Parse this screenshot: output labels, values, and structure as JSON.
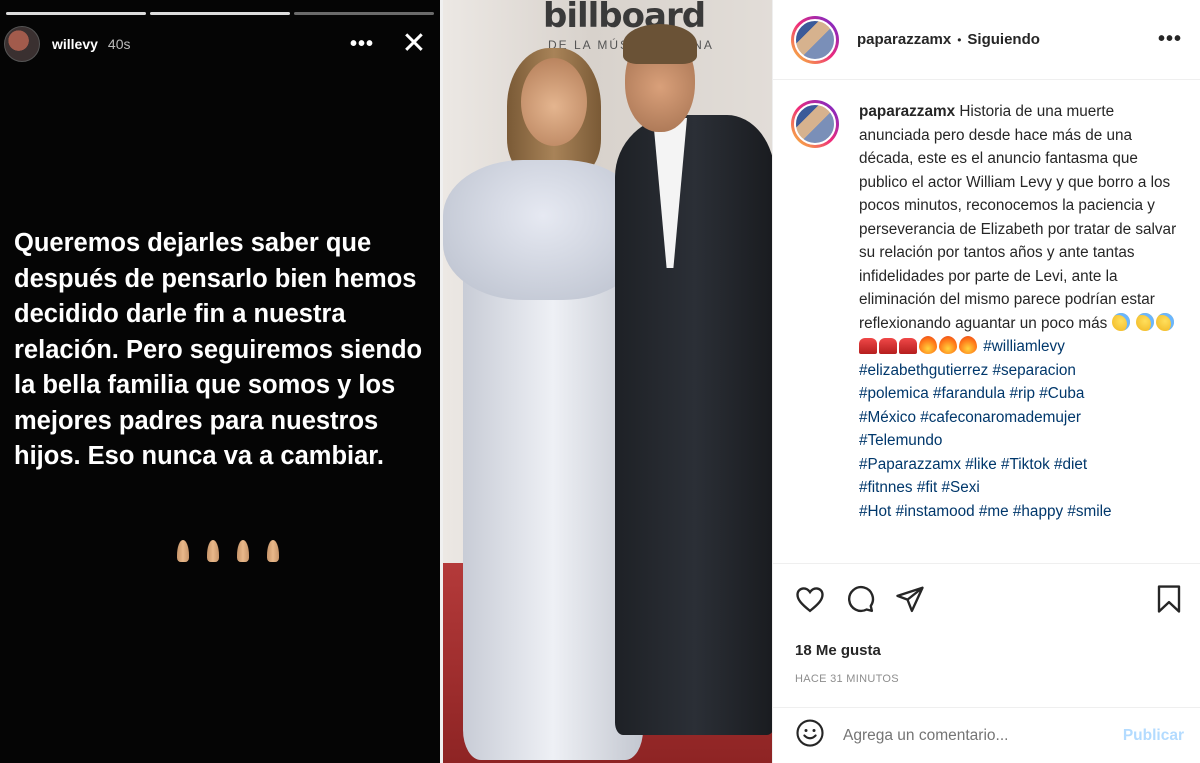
{
  "story": {
    "username": "willevy",
    "age": "40s",
    "more_icon": "more-horizontal-icon",
    "close_icon": "close-icon",
    "message": "Queremos dejarles saber que después de pensarlo bien hemos decidido darle fin a nuestra relación. Pero seguiremos siendo la bella familia que somos y los mejores padres para nuestros hijos. Eso nunca va a cambiar."
  },
  "photo": {
    "backdrop_text": "billboard",
    "backdrop_sub": "DE LA MÚSICA LATINA"
  },
  "post": {
    "username": "paparazzamx",
    "separator": "•",
    "follow_status": "Siguiendo",
    "caption_user": "paparazzamx",
    "caption_text": "Historia de una muerte anunciada pero desde hace más de una década, este es el anuncio fantasma que publico el actor William Levy y que borro a los pocos minutos, reconocemos la paciencia y perseverancia de Elizabeth por tratar de salvar su relación por tantos años y ante tantas infidelidades por parte de Levi, ante la eliminación del mismo parece podrían estar reflexionando aguantar un poco más",
    "hashtags_line1": [
      "#williamlevy"
    ],
    "hashtags_line2": [
      "#elizabethgutierrez",
      "#separacion"
    ],
    "hashtags_line3": [
      "#polemica",
      "#farandula",
      "#rip",
      "#Cuba"
    ],
    "hashtags_line4": [
      "#México",
      "#cafeconaromademujer"
    ],
    "hashtags_line5": [
      "#Telemundo"
    ],
    "hashtags_line6": [
      "#Paparazzamx",
      "#like",
      "#Tiktok",
      "#diet"
    ],
    "hashtags_line7": [
      "#fitnnes",
      "#fit",
      "#Sexi"
    ],
    "hashtags_line8": [
      "#Hot",
      "#instamood",
      "#me",
      "#happy",
      "#smile"
    ],
    "likes": "18 Me gusta",
    "time": "HACE 31 MINUTOS",
    "comment_placeholder": "Agrega un comentario...",
    "publish_label": "Publicar",
    "link_color": "#00376b"
  }
}
